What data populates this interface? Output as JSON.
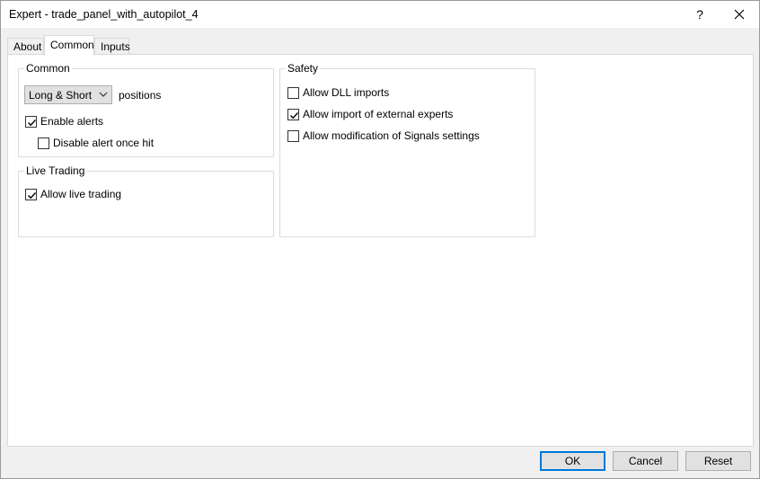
{
  "window": {
    "title": "Expert - trade_panel_with_autopilot_4",
    "help_label": "?",
    "close_label": "✕"
  },
  "tabs": [
    {
      "label": "About",
      "active": false
    },
    {
      "label": "Common",
      "active": true
    },
    {
      "label": "Inputs",
      "active": false
    }
  ],
  "common": {
    "group_title": "Common",
    "positions_select": "Long & Short",
    "positions_label": "positions",
    "enable_alerts": {
      "label": "Enable alerts",
      "checked": true
    },
    "disable_alert_once_hit": {
      "label": "Disable alert once hit",
      "checked": false
    }
  },
  "live_trading": {
    "group_title": "Live Trading",
    "allow_live_trading": {
      "label": "Allow live trading",
      "checked": true
    }
  },
  "safety": {
    "group_title": "Safety",
    "allow_dll_imports": {
      "label": "Allow DLL imports",
      "checked": false
    },
    "allow_import_external": {
      "label": "Allow import of external experts",
      "checked": true
    },
    "allow_modification_signals": {
      "label": "Allow modification of Signals settings",
      "checked": false
    }
  },
  "buttons": {
    "ok": "OK",
    "cancel": "Cancel",
    "reset": "Reset"
  },
  "colors": {
    "accent": "#0078d7",
    "panel_bg": "#ffffff",
    "window_bg": "#f0f0f0"
  }
}
